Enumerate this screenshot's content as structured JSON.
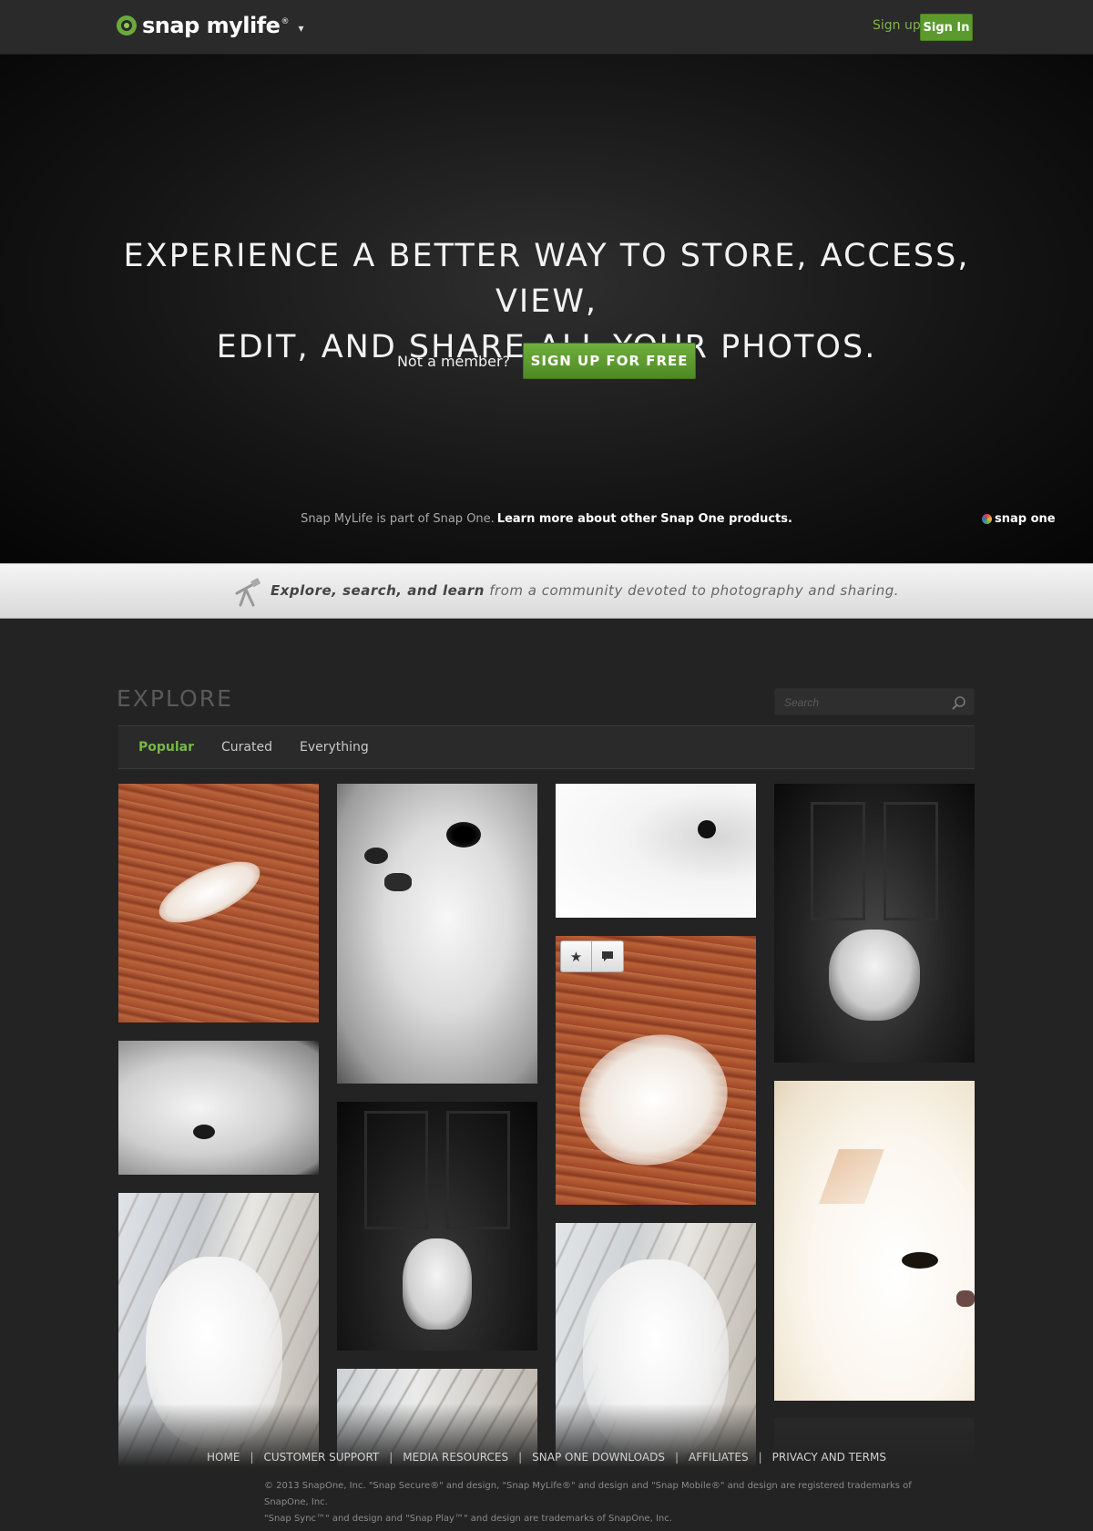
{
  "header": {
    "logo_text": "snap mylife",
    "logo_reg": "®",
    "caret": "▾",
    "signup_label": "Sign up",
    "signin_label": "Sign In"
  },
  "hero": {
    "title_line1": "EXPERIENCE A BETTER WAY TO STORE, ACCESS, VIEW,",
    "title_line2": "EDIT, AND SHARE ALL YOUR PHOTOS.",
    "not_member": "Not a member?",
    "cta_label": "SIGN UP FOR FREE",
    "foot_text": "Snap MyLife is part of Snap One.",
    "foot_link": "Learn more about other Snap One products.",
    "brand": "snap one"
  },
  "banner": {
    "bold": "Explore, search, and learn",
    "rest": "from a community devoted to photography and sharing."
  },
  "explore": {
    "title": "EXPLORE",
    "search_placeholder": "Search",
    "tabs": [
      {
        "label": "Popular",
        "active": true
      },
      {
        "label": "Curated",
        "active": false
      },
      {
        "label": "Everything",
        "active": false
      }
    ]
  },
  "photos": [
    {
      "name": "photo-cat-floor-lying",
      "tone": "wood"
    },
    {
      "name": "photo-cat-face-bw",
      "tone": "bw"
    },
    {
      "name": "photo-cat-profile-white",
      "tone": "white"
    },
    {
      "name": "photo-cat-door-dark",
      "tone": "dark"
    },
    {
      "name": "photo-cat-closeup-bw",
      "tone": "bw"
    },
    {
      "name": "photo-cat-door-sitting",
      "tone": "dark"
    },
    {
      "name": "photo-cat-floor-rolling",
      "tone": "wood"
    },
    {
      "name": "photo-cat-warm-closeup",
      "tone": "warm"
    },
    {
      "name": "photo-cat-licking",
      "tone": "porch"
    },
    {
      "name": "photo-cat-porch-up",
      "tone": "porch"
    },
    {
      "name": "photo-cat-porch-small",
      "tone": "porch"
    },
    {
      "name": "photo-dark-partial",
      "tone": "dark"
    }
  ],
  "photo_tools": {
    "star": "★",
    "comment": "comment"
  },
  "footer": {
    "links": [
      "HOME",
      "CUSTOMER SUPPORT",
      "MEDIA RESOURCES",
      "SNAP ONE DOWNLOADS",
      "AFFILIATES",
      "PRIVACY AND TERMS"
    ],
    "separator": "|",
    "legal_1": "© 2013 SnapOne, Inc. \"Snap Secure®\" and design, \"Snap MyLife®\" and design and \"Snap Mobile®\" and design are registered trademarks of SnapOne, Inc.",
    "legal_2": "\"Snap Sync™\" and design and \"Snap Play™\" and design are trademarks of SnapOne, Inc."
  },
  "colors": {
    "accent": "#7ab648",
    "button": "#5c9a2e",
    "page_bg": "#232323"
  }
}
